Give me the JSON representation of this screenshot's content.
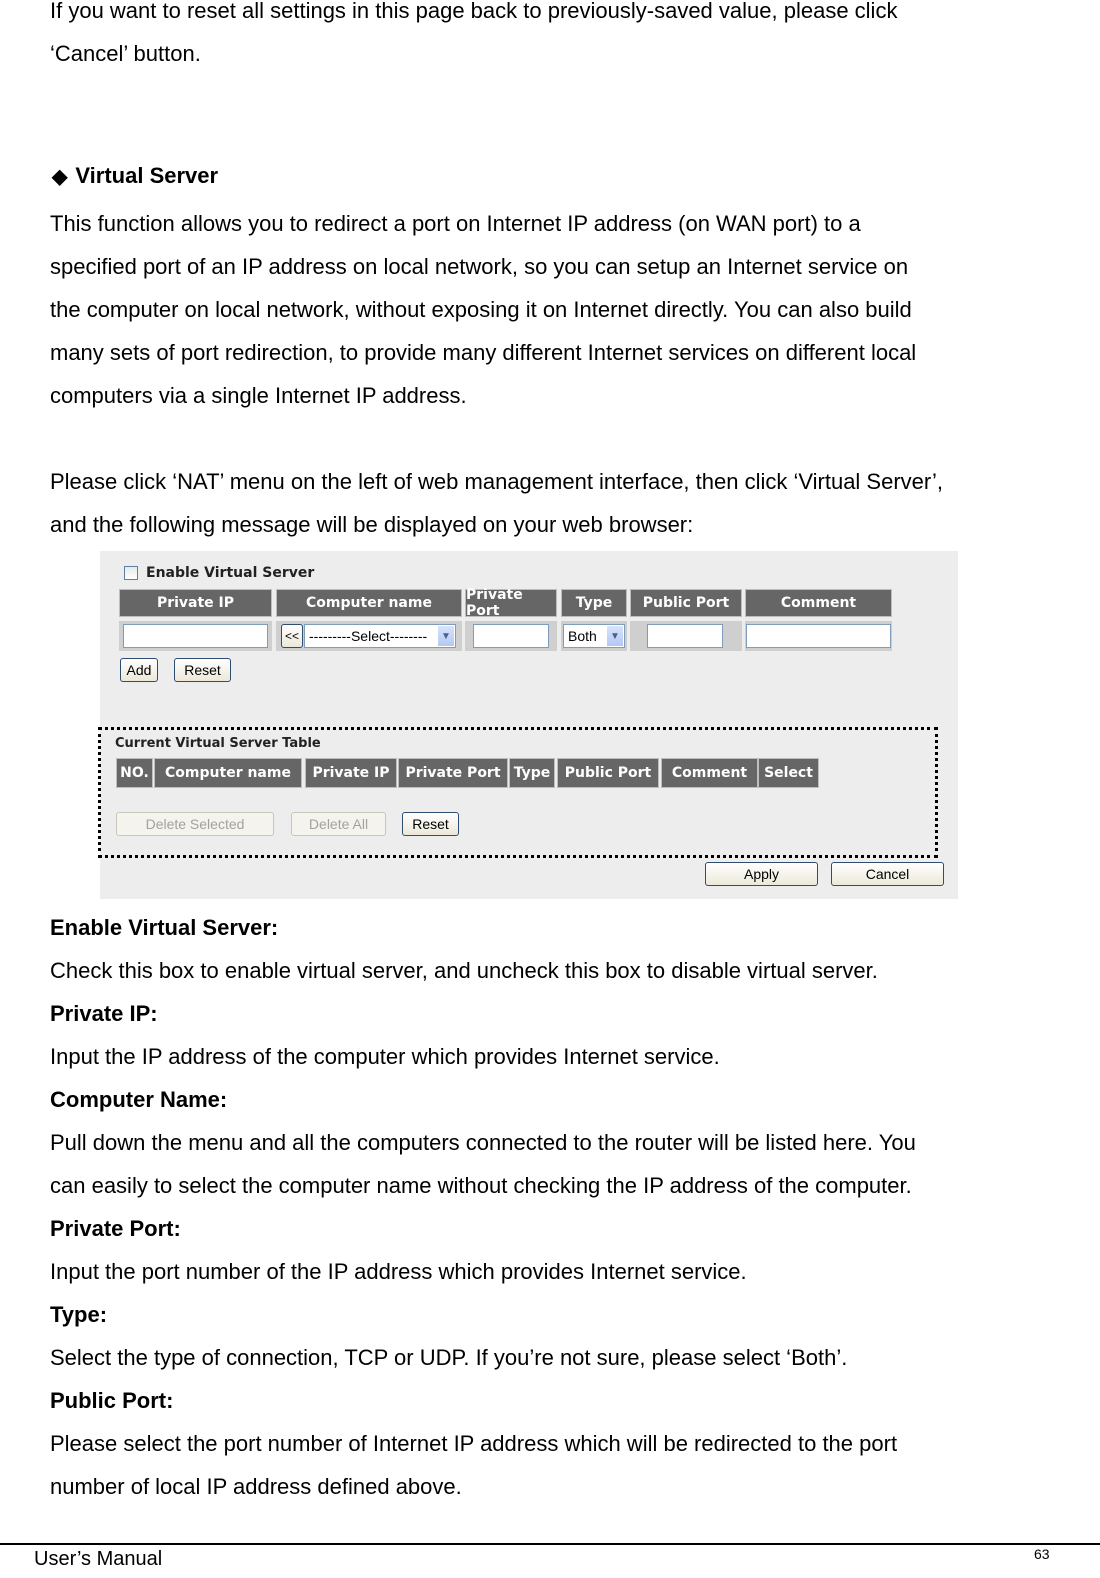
{
  "intro": {
    "lines": [
      "If you want to reset all settings in this page back to previously-saved value, please click",
      "‘Cancel’ button."
    ]
  },
  "section": {
    "bullet_icon": "◆",
    "title": "Virtual Server",
    "description_lines": [
      "This function allows you to redirect a port on Internet IP address (on WAN port) to a",
      "specified port of an IP address on local network, so you can setup an Internet service on",
      "the computer on local network, without exposing it on Internet directly. You can also build",
      "many sets of port redirection, to provide many different Internet services on different local",
      "computers via a single Internet IP address."
    ],
    "instruction_lines": [
      "Please click ‘NAT’ menu on the left of web management interface, then click ‘Virtual Server’,",
      "and the following message will be displayed on your web browser:"
    ]
  },
  "screenshot": {
    "enable_label": "Enable Virtual Server",
    "enable_checked": false,
    "input_headers": [
      "Private IP",
      "Computer name",
      "Private Port",
      "Type",
      "Public Port",
      "Comment"
    ],
    "inputs": {
      "private_ip": "",
      "computer_back_button": "<<",
      "computer_select": "---------Select--------",
      "private_port": "",
      "type_select": "Both",
      "public_port": "",
      "comment": ""
    },
    "add_button": "Add",
    "reset_button": "Reset",
    "table_title": "Current Virtual Server Table",
    "table_headers": [
      "NO.",
      "Computer name",
      "Private IP",
      "Private Port",
      "Type",
      "Public Port",
      "Comment",
      "Select"
    ],
    "table_rows": [],
    "delete_selected_button": "Delete Selected",
    "delete_all_button": "Delete All",
    "table_reset_button": "Reset",
    "apply_button": "Apply",
    "cancel_button": "Cancel"
  },
  "fields": [
    {
      "term": "Enable Virtual Server:",
      "lines": [
        "Check this box to enable virtual server, and uncheck this box to disable virtual server."
      ]
    },
    {
      "term": "Private IP:",
      "lines": [
        "Input the IP address of the computer which provides Internet service."
      ]
    },
    {
      "term": "Computer Name:",
      "lines": [
        "Pull down the menu and all the computers connected to the router will be listed here. You",
        "can easily to select the computer name without checking the IP address of the computer."
      ]
    },
    {
      "term": "Private Port:",
      "lines": [
        "Input the port number of the IP address which provides Internet service."
      ]
    },
    {
      "term": "Type:",
      "lines": [
        "Select the type of connection, TCP or UDP. If you’re not sure, please select ‘Both’."
      ]
    },
    {
      "term": "Public Port:",
      "lines": [
        "Please select the port number of Internet IP address which will be redirected to the port",
        "number of local IP address defined above."
      ]
    }
  ],
  "footer": {
    "left": "User’s Manual",
    "page_number": "63"
  }
}
